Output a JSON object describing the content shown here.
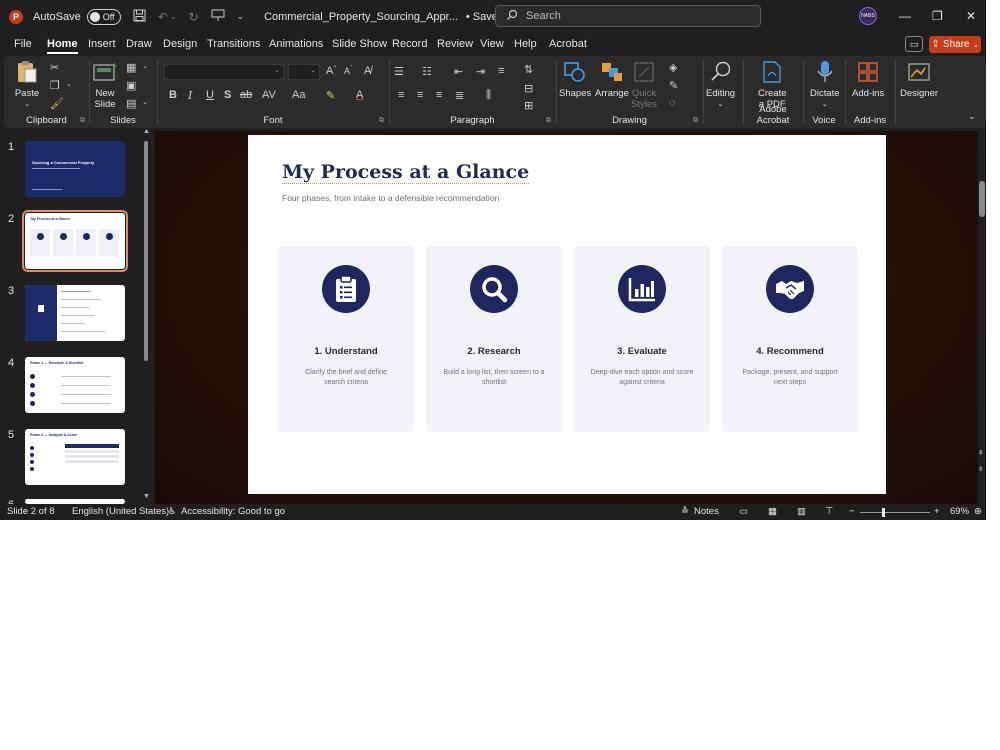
{
  "titlebar": {
    "autosave_label": "AutoSave",
    "autosave_state": "Off",
    "filename": "Commercial_Property_Sourcing_Appr...",
    "saved_status": "• Saved to this PC ∨",
    "search_placeholder": "Search",
    "avatar_text": "NABS"
  },
  "menu": {
    "tabs": [
      "File",
      "Home",
      "Insert",
      "Draw",
      "Design",
      "Transitions",
      "Animations",
      "Slide Show",
      "Record",
      "Review",
      "View",
      "Help",
      "Acrobat"
    ],
    "active": "Home",
    "share_label": "Share"
  },
  "ribbon": {
    "paste": "Paste",
    "new_slide_1": "New",
    "new_slide_2": "Slide",
    "groups": {
      "clipboard": "Clipboard",
      "slides": "Slides",
      "font": "Font",
      "paragraph": "Paragraph",
      "drawing": "Drawing",
      "adobe": "Adobe Acrobat",
      "voice": "Voice",
      "addins": "Add-ins"
    },
    "shapes": "Shapes",
    "arrange": "Arrange",
    "quick_styles_1": "Quick",
    "quick_styles_2": "Styles",
    "editing": "Editing",
    "create_pdf_1": "Create",
    "create_pdf_2": "a PDF",
    "dictate": "Dictate",
    "addins_btn": "Add-ins",
    "designer": "Designer"
  },
  "thumbnails": [
    {
      "num": "1",
      "title": "Sourcing a Commercial Property"
    },
    {
      "num": "2",
      "title": "My Process at a Glance"
    },
    {
      "num": "3",
      "title": ""
    },
    {
      "num": "4",
      "title": "Phase 1 — Research & Shortlist"
    },
    {
      "num": "5",
      "title": "Phase 2 — Analysis & Score"
    },
    {
      "num": "6",
      "title": ""
    }
  ],
  "slide": {
    "title": "My Process at a Glance",
    "subtitle": "Four phases, from intake to a defensible recommendation",
    "cards": [
      {
        "title": "1. Understand",
        "desc": "Clarify the brief and define search criteria",
        "icon": "clipboard-icon"
      },
      {
        "title": "2. Research",
        "desc": "Build a long list, then screen to a shortlist",
        "icon": "magnifier-icon"
      },
      {
        "title": "3. Evaluate",
        "desc": "Deep-dive each option and score against criteria",
        "icon": "bar-chart-icon"
      },
      {
        "title": "4. Recommend",
        "desc": "Package, present, and support next steps",
        "icon": "handshake-icon"
      }
    ]
  },
  "status": {
    "slide_count": "Slide 2 of 8",
    "language": "English (United States)",
    "accessibility": "Accessibility: Good to go",
    "notes": "Notes",
    "zoom": "69%"
  },
  "colors": {
    "accent_navy": "#1e2660",
    "share_orange": "#c43e1c",
    "card_bg": "#f2f3f8"
  }
}
